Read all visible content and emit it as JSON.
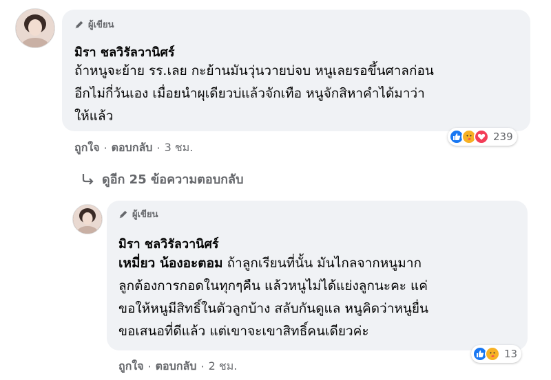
{
  "comment1": {
    "author_badge": "ผู้เขียน",
    "name": "มิรา ชลวิรัลวานิศร์",
    "lines": [
      "ถ้าหนูจะย้าย รร.เลย กะย้านมันวุ่นวายบ่จบ หนูเลยรอขึ้นศาลก่อน",
      "อีกไม่กี่วันเอง เมื่อยนำผุเดียวบ่แล้วจักเทือ หนูจักสิหาคำได้มาว่า",
      "ให้แล้ว"
    ],
    "actions": {
      "like": "ถูกใจ",
      "reply": "ตอบกลับ",
      "time": "3 ชม."
    },
    "reactions": {
      "count": "239",
      "icons": [
        "like-icon",
        "care-icon",
        "love-icon"
      ]
    }
  },
  "view_more_replies": "ดูอีก 25 ข้อความตอบกลับ",
  "comment2": {
    "author_badge": "ผู้เขียน",
    "name": "มิรา ชลวิรัลวานิศร์",
    "mention": "เหมี่ยว น้องอะตอม",
    "lines": [
      "ถ้าลูกเรียนที่นั้น มันไกลจากหนูมาก",
      "ลูกต้องการกอดในทุกๆคืน แล้วหนูไม่ได้แย่งลูกนะคะ แค่",
      "ขอให้หนูมีสิทธิ์ในตัวลูกบ้าง สลับกันดูแล หนูคิดว่าหนูยื่น",
      "ขอเสนอที่ดีแล้ว แต่เขาจะเขาสิทธิ์คนเดียวค่ะ"
    ],
    "actions": {
      "like": "ถูกใจ",
      "reply": "ตอบกลับ",
      "time": "2 ชม."
    },
    "reactions": {
      "count": "13",
      "icons": [
        "like-icon",
        "care-icon"
      ]
    }
  },
  "colors": {
    "bubble": "#f0f2f5",
    "muted": "#65676b",
    "like_blue": "#1877f2",
    "love_red": "#f33e58",
    "care_yellow": "#f7b125"
  }
}
